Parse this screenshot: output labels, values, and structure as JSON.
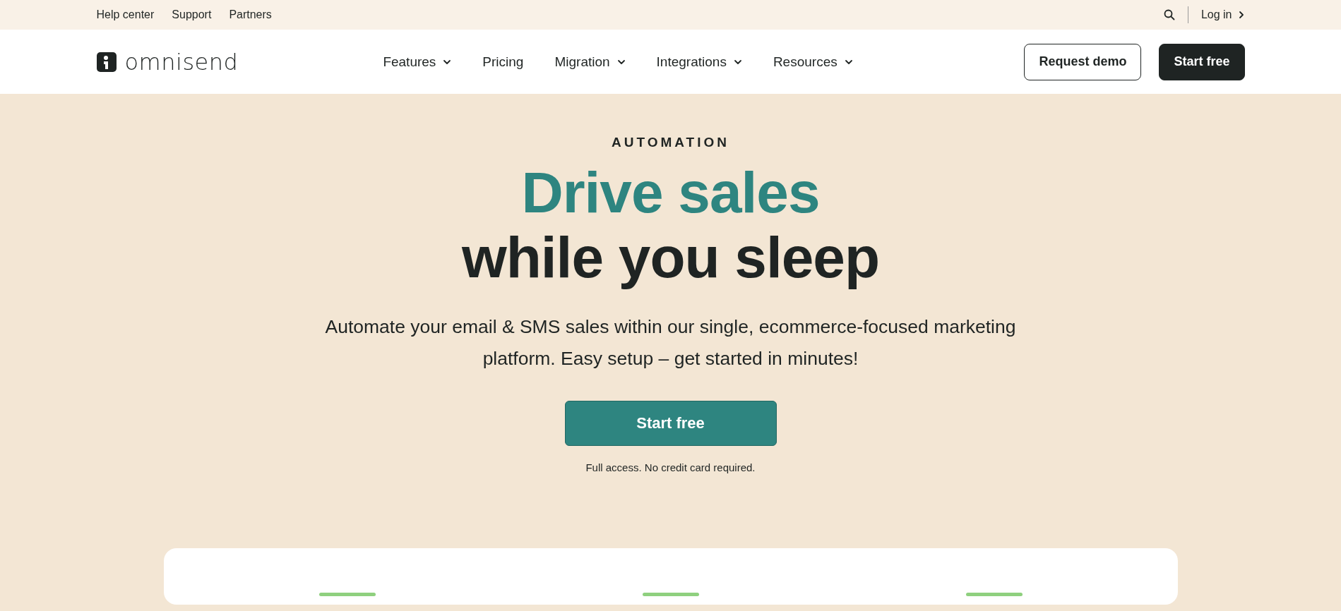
{
  "top_bar": {
    "links": [
      "Help center",
      "Support",
      "Partners"
    ],
    "login": "Log in"
  },
  "header": {
    "logo": "omnisend",
    "nav": [
      {
        "label": "Features",
        "dropdown": true
      },
      {
        "label": "Pricing",
        "dropdown": false
      },
      {
        "label": "Migration",
        "dropdown": true
      },
      {
        "label": "Integrations",
        "dropdown": true
      },
      {
        "label": "Resources",
        "dropdown": true
      }
    ],
    "buttons": [
      {
        "label": "Request demo",
        "kind": "outline"
      },
      {
        "label": "Start free",
        "kind": "dark"
      }
    ]
  },
  "hero": {
    "eyebrow": "AUTOMATION",
    "title_accent": "Drive sales",
    "title": "while you sleep",
    "subtitle": "Automate your email & SMS sales within our single, ecommerce-focused marketing platform. Easy setup – get started in minutes!",
    "cta": "Start free",
    "note": "Full access. No credit card required."
  },
  "card": {
    "columns": [
      {
        "kind": "accent"
      },
      {
        "kind": "accent"
      },
      {
        "kind": "accent"
      }
    ]
  }
}
